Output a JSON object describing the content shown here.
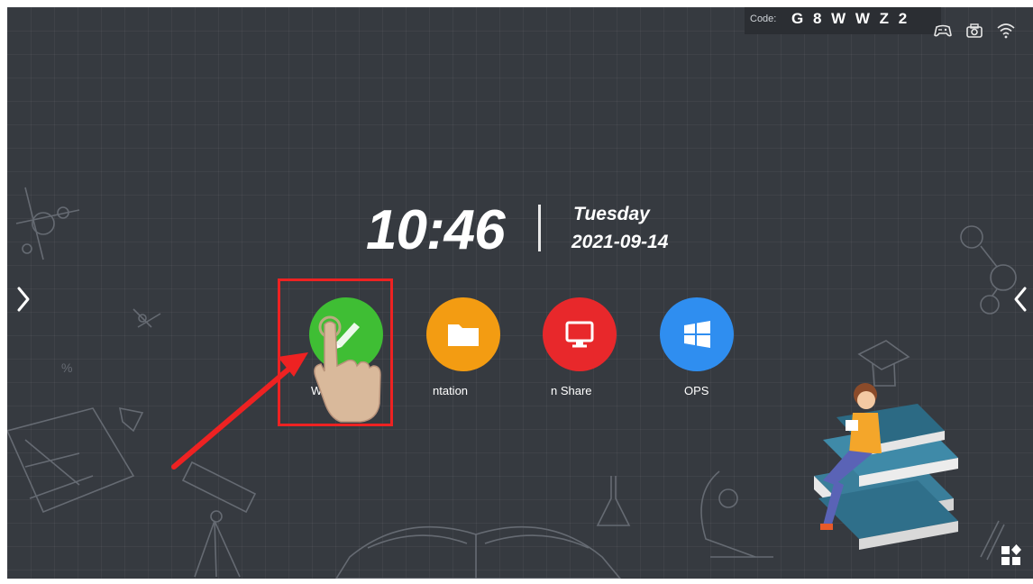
{
  "statusbar": {
    "code_label": "Code:",
    "code_value": "G 8 W W Z 2",
    "icons": [
      "gamepad-icon",
      "camera-icon",
      "wifi-icon"
    ]
  },
  "clock": {
    "time": "10:46",
    "day": "Tuesday",
    "date": "2021-09-14"
  },
  "apps": [
    {
      "label": "Wr",
      "icon": "pen-icon",
      "color": "#3fbe34"
    },
    {
      "label": "ntation",
      "icon": "folder-icon",
      "color": "#f39c12"
    },
    {
      "label": "n Share",
      "icon": "screen-share-icon",
      "color": "#e8282b"
    },
    {
      "label": "OPS",
      "icon": "windows-icon",
      "color": "#2f8ef0"
    }
  ],
  "colors": {
    "background": "#363a40",
    "highlight": "#ee2222",
    "text": "#ffffff"
  }
}
